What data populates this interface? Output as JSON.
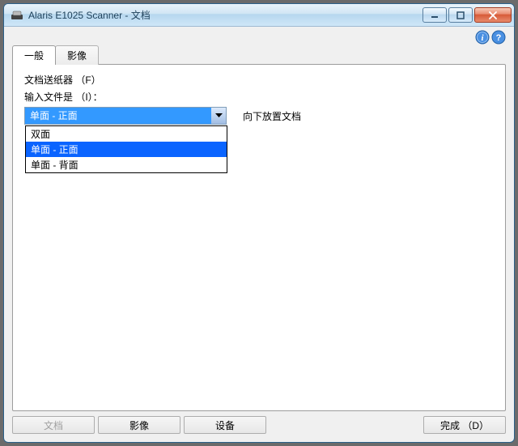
{
  "window": {
    "title": "Alaris E1025 Scanner - 文档"
  },
  "tabs": {
    "general": "一般",
    "image": "影像"
  },
  "panel": {
    "feeder_label": "文档送纸器 （F）",
    "input_label": "输入文件是 （I）：",
    "dropdown_value": "单面 - 正面",
    "hint": "向下放置文档",
    "options": {
      "duplex": "双面",
      "front": "单面 - 正面",
      "back": "单面 - 背面"
    }
  },
  "buttons": {
    "document": "文档",
    "image": "影像",
    "device": "设备",
    "done": "完成 （D）"
  }
}
